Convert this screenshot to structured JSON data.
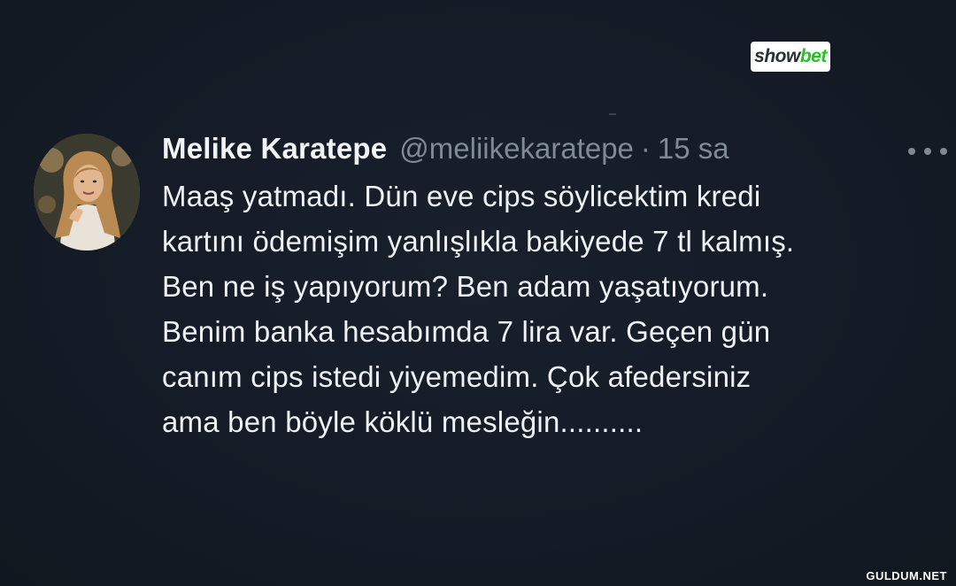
{
  "brand": {
    "logo_show": "show",
    "logo_bet": "bet",
    "colors": {
      "show": "#2a2f36",
      "bet": "#22c41f"
    }
  },
  "tweet": {
    "author": {
      "display_name": "Melike Karatepe",
      "handle": "@meliikekaratepe",
      "separator": "·",
      "time": "15 sa",
      "avatar_icon": "profile-photo"
    },
    "more_icon": "more-horizontal-icon",
    "text_lines": [
      "Maaş yatmadı. Dün eve cips söylicektim kredi",
      "kartını ödemişim yanlışlıkla bakiyede 7 tl kalmış.",
      "Ben ne iş yapıyorum? Ben adam yaşatıyorum.",
      "Benim banka hesabımda 7 lira var. Geçen gün",
      "canım cips istedi yiyemedim. Çok afedersiniz",
      "ama ben böyle köklü mesleğin.........."
    ]
  },
  "watermark": {
    "text": "GULDUM.NET"
  },
  "theme": {
    "background": "#141b26",
    "text_primary": "#eef1f4",
    "text_secondary": "#7f8a96"
  }
}
